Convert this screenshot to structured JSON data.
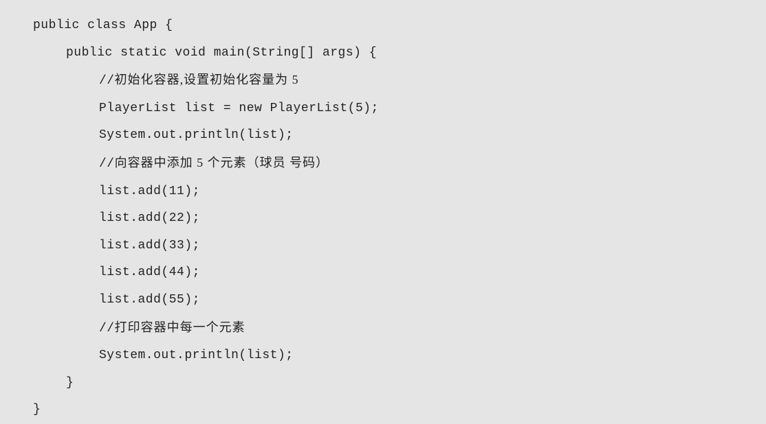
{
  "code": {
    "line1": "public class App {",
    "line2": "public static void main(String[] args) {",
    "comment1_prefix": "//",
    "comment1_text": "初始化容器,设置初始化容量为 5",
    "line4": "PlayerList list = new PlayerList(5);",
    "line5": "System.out.println(list);",
    "comment2_prefix": "//",
    "comment2_text": "向容器中添加 5 个元素（球员 号码）",
    "line7": "list.add(11);",
    "line8": "list.add(22);",
    "line9": "list.add(33);",
    "line10": "list.add(44);",
    "line11": "list.add(55);",
    "comment3_prefix": "//",
    "comment3_text": "打印容器中每一个元素",
    "line13": "System.out.println(list);",
    "line14": "}",
    "line15": "}"
  }
}
